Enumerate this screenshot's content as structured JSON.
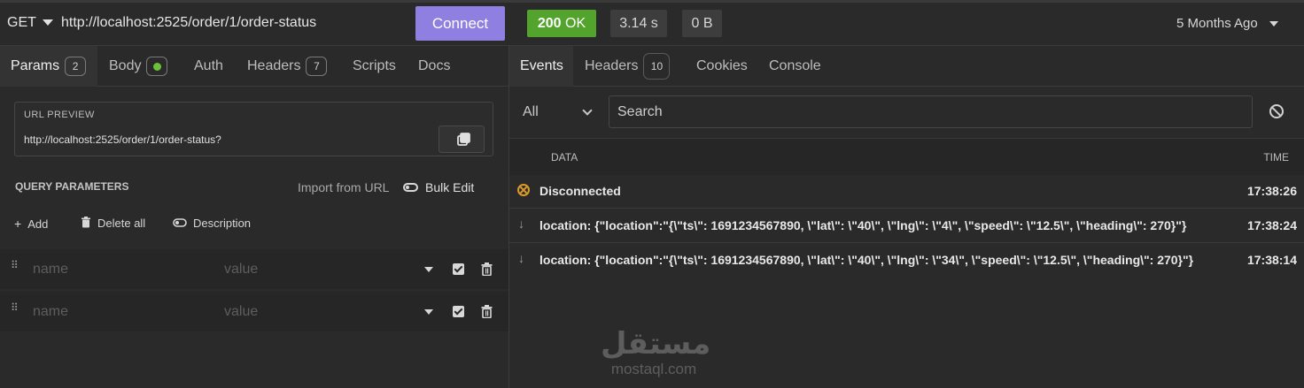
{
  "request": {
    "method": "GET",
    "url": "http://localhost:2525/order/1/order-status",
    "connect_label": "Connect"
  },
  "response": {
    "status_code": "200",
    "status_text": "OK",
    "status_color": "#52a42c",
    "duration": "3.14 s",
    "size": "0 B",
    "time_ago": "5 Months Ago"
  },
  "left_tabs": [
    {
      "label": "Params",
      "badge": "2"
    },
    {
      "label": "Body"
    },
    {
      "label": "Auth"
    },
    {
      "label": "Headers",
      "badge": "7"
    },
    {
      "label": "Scripts"
    },
    {
      "label": "Docs"
    }
  ],
  "url_preview": {
    "label": "URL PREVIEW",
    "value": "http://localhost:2525/order/1/order-status?"
  },
  "query_params": {
    "title": "QUERY PARAMETERS",
    "import_label": "Import from URL",
    "bulk_edit_label": "Bulk Edit",
    "add_label": "Add",
    "delete_all_label": "Delete all",
    "description_label": "Description",
    "rows": [
      {
        "name_placeholder": "name",
        "value_placeholder": "value",
        "enabled": true
      },
      {
        "name_placeholder": "name",
        "value_placeholder": "value",
        "enabled": true
      }
    ]
  },
  "right_tabs": [
    {
      "label": "Events"
    },
    {
      "label": "Headers",
      "badge": "10"
    },
    {
      "label": "Cookies"
    },
    {
      "label": "Console"
    }
  ],
  "events": {
    "filter_value": "All",
    "search_placeholder": "Search",
    "col_data": "DATA",
    "col_time": "TIME",
    "rows": [
      {
        "icon": "disconnect-icon",
        "text": "Disconnected",
        "time": "17:38:26"
      },
      {
        "icon": "arrow-down-icon",
        "text": "location: {\"location\":\"{\\\"ts\\\": 1691234567890, \\\"lat\\\": \\\"40\\\", \\\"lng\\\": \\\"4\\\", \\\"speed\\\": \\\"12.5\\\", \\\"heading\\\": 270}\"}",
        "time": "17:38:24"
      },
      {
        "icon": "arrow-down-icon",
        "text": "location: {\"location\":\"{\\\"ts\\\": 1691234567890, \\\"lat\\\": \\\"40\\\", \\\"lng\\\": \\\"34\\\", \\\"speed\\\": \\\"12.5\\\", \\\"heading\\\": 270}\"}",
        "time": "17:38:14"
      }
    ]
  },
  "watermark": {
    "arabic": "مستقل",
    "latin": "mostaql.com"
  },
  "colors": {
    "accent": "#8f7fe0",
    "background": "#2a2a2a",
    "body_dot": "#6cc03a",
    "disconnect": "#d99a2a"
  }
}
